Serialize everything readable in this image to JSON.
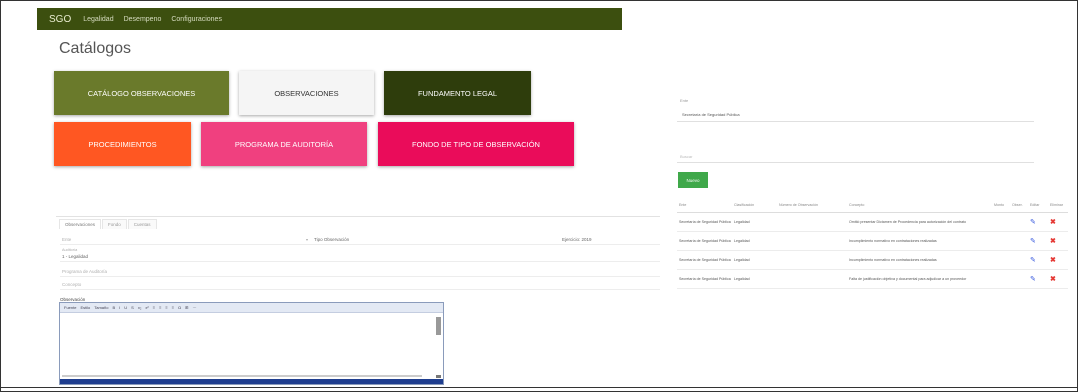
{
  "navbar": {
    "brand": "SGO",
    "items": [
      "Legalidad",
      "Desempeno",
      "Configuraciones"
    ]
  },
  "page_title": "Catálogos",
  "tiles": [
    {
      "label": "CATÁLOGO OBSERVACIONES",
      "color": "#6a7a2b"
    },
    {
      "label": "OBSERVACIONES",
      "color": "#f5f5f5"
    },
    {
      "label": "FUNDAMENTO LEGAL",
      "color": "#2e3d0c"
    },
    {
      "label": "PROCEDIMIENTOS",
      "color": "#ff5722"
    },
    {
      "label": "PROGRAMA DE AUDITORÍA",
      "color": "#f0407f"
    },
    {
      "label": "FONDO DE TIPO DE OBSERVACIÓN",
      "color": "#ea0c5a"
    }
  ],
  "form": {
    "tabs": [
      "Observaciones",
      "Fondo",
      "Cuentas"
    ],
    "ente_label": "Ente",
    "tipo_label": "Tipo Observación",
    "ejercicio_label": "Ejercicio: 2019",
    "auditoria_label": "Auditoría",
    "auditoria_value": "1 - Legalidad",
    "programa_label": "Programa de Auditoría",
    "concepto_label": "Concepto",
    "observacion_label": "Observación"
  },
  "editor": {
    "toolbar": [
      "Fuente",
      "Estilo",
      "Tamaño",
      "B",
      "I",
      "U",
      "S",
      "x₂",
      "x²",
      "≡",
      "≡",
      "≡",
      "≡",
      "Ω",
      "⊞",
      "⋯"
    ]
  },
  "right": {
    "ente_label": "Ente",
    "ente_value": "Secretaría de Seguridad Pública",
    "buscar_placeholder": "Buscar",
    "btn_label": "Nuevo",
    "columns": [
      "Ente",
      "Clasificación",
      "Número de Observación",
      "Concepto",
      "Monto",
      "Obser.",
      "Editar",
      "Eliminar"
    ],
    "rows": [
      [
        "Secretaría de Seguridad Pública",
        "Legalidad",
        "",
        "Omitió presentar Dictamen de Procedencia para autorización del contrato"
      ],
      [
        "Secretaría de Seguridad Pública",
        "Legalidad",
        "",
        "Incumplimiento normativo en contrataciones realizadas"
      ],
      [
        "Secretaría de Seguridad Pública",
        "Legalidad",
        "",
        "Incumplimiento normativo en contrataciones realizadas"
      ],
      [
        "Secretaría de Seguridad Pública",
        "Legalidad",
        "",
        "Falta de justificación objetiva y documental para adjudicar a un proveedor"
      ]
    ]
  }
}
